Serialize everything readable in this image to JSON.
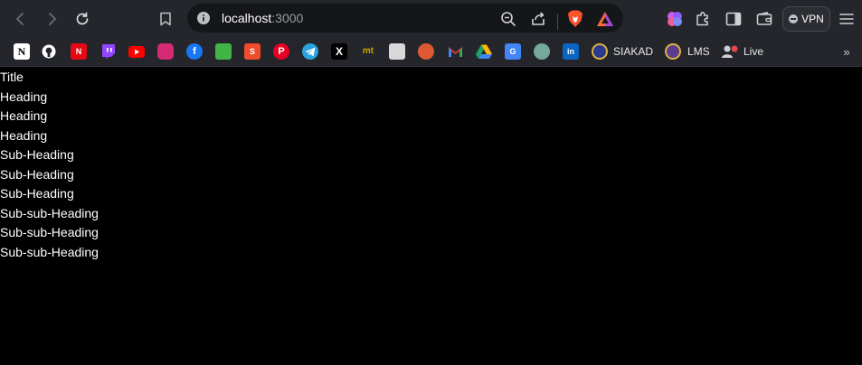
{
  "browser": {
    "url_host": "localhost",
    "url_port": ":3000",
    "vpn_label": "VPN"
  },
  "bookmarks": [
    {
      "name": "notion",
      "icon": "notion-icon",
      "color": "#ffffff",
      "text": "N"
    },
    {
      "name": "github",
      "icon": "github-icon",
      "color": "#ffffff",
      "text": ""
    },
    {
      "name": "netflix",
      "icon": "netflix-icon",
      "color": "#e50914",
      "text": "N"
    },
    {
      "name": "twitch",
      "icon": "twitch-icon",
      "color": "#9146ff",
      "text": ""
    },
    {
      "name": "youtube",
      "icon": "youtube-icon",
      "color": "#ff0000",
      "text": ""
    },
    {
      "name": "instagram",
      "icon": "instagram-icon",
      "color": "#d62976",
      "text": ""
    },
    {
      "name": "facebook",
      "icon": "facebook-icon",
      "color": "#1877f2",
      "text": "f"
    },
    {
      "name": "tokopedia",
      "icon": "tokopedia-icon",
      "color": "#42b549",
      "text": ""
    },
    {
      "name": "shopee",
      "icon": "shopee-icon",
      "color": "#ee4d2d",
      "text": "S"
    },
    {
      "name": "pinterest",
      "icon": "pinterest-icon",
      "color": "#e60023",
      "text": "P"
    },
    {
      "name": "telegram",
      "icon": "telegram-icon",
      "color": "#2aa3df",
      "text": ""
    },
    {
      "name": "x",
      "icon": "x-icon",
      "color": "#ffffff",
      "text": "X"
    },
    {
      "name": "mt",
      "icon": "mt-icon",
      "color": "#c8a400",
      "text": "mt"
    },
    {
      "name": "docs",
      "icon": "document-icon",
      "color": "#d9d9d9",
      "text": ""
    },
    {
      "name": "duckduckgo",
      "icon": "duckduckgo-icon",
      "color": "#de5833",
      "text": ""
    },
    {
      "name": "gmail",
      "icon": "gmail-icon",
      "color": "#ea4335",
      "text": "M"
    },
    {
      "name": "google-drive",
      "icon": "google-drive-icon",
      "color": "#1fa463",
      "text": ""
    },
    {
      "name": "google-translate",
      "icon": "translate-icon",
      "color": "#4285f4",
      "text": "G"
    },
    {
      "name": "chatgpt",
      "icon": "chatgpt-icon",
      "color": "#74aa9c",
      "text": ""
    },
    {
      "name": "linkedin",
      "icon": "linkedin-icon",
      "color": "#0a66c2",
      "text": "in"
    },
    {
      "name": "siakad",
      "icon": "siakad-logo-icon",
      "color": "#2a3b8f",
      "text": "",
      "label": "SIAKAD"
    },
    {
      "name": "lms",
      "icon": "lms-logo-icon",
      "color": "#5a3d8f",
      "text": "",
      "label": "LMS"
    },
    {
      "name": "live",
      "icon": "live-icon",
      "color": "#cfcfd4",
      "text": "",
      "label": "Live"
    }
  ],
  "content": {
    "lines": [
      "Title",
      "Heading",
      "Heading",
      "Heading",
      "Sub-Heading",
      "Sub-Heading",
      "Sub-Heading",
      "Sub-sub-Heading",
      "Sub-sub-Heading",
      "Sub-sub-Heading"
    ]
  }
}
